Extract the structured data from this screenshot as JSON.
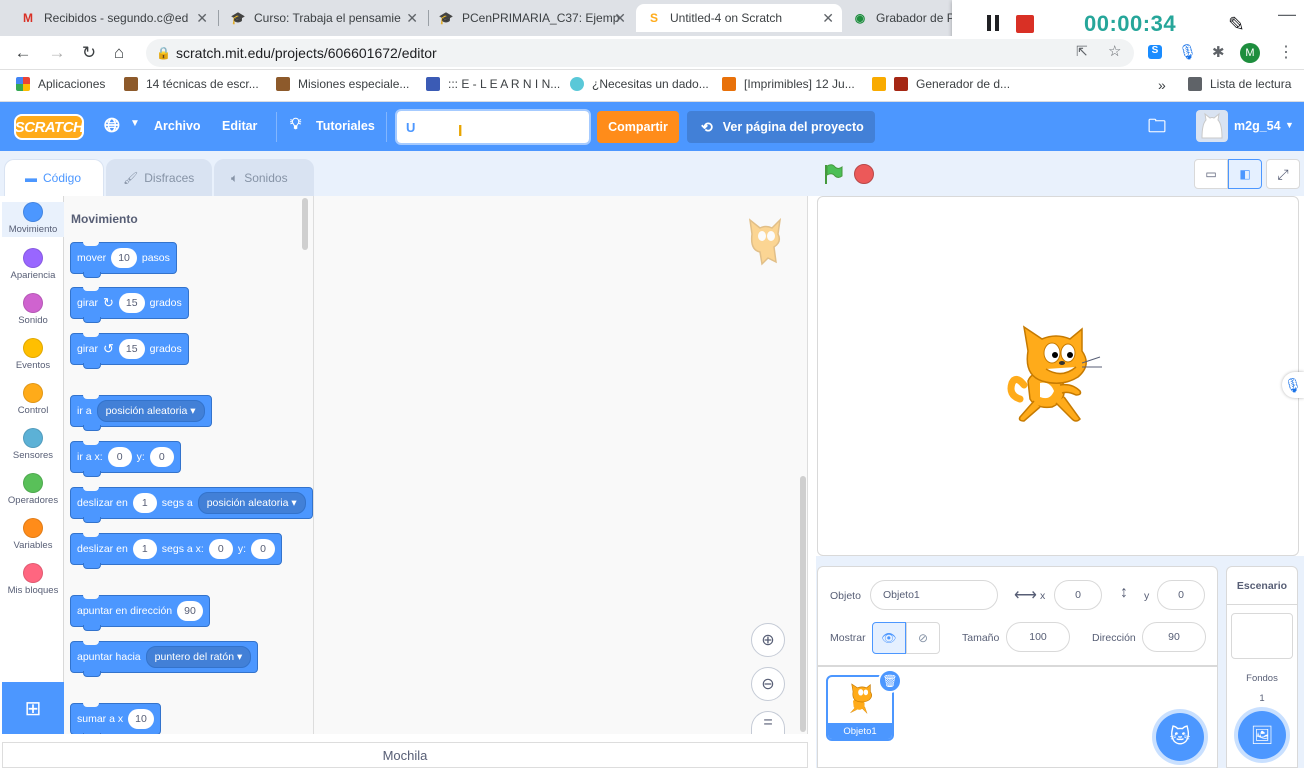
{
  "browser": {
    "tabs": [
      {
        "label": "Recibidos - segundo.c@ed",
        "icon": "gmail-icon"
      },
      {
        "label": "Curso: Trabaja el pensamie",
        "icon": "course-icon"
      },
      {
        "label": "PCenPRIMARIA_C37: Ejemp",
        "icon": "course-icon"
      },
      {
        "label": "Untitled-4 on Scratch",
        "icon": "scratch-icon"
      },
      {
        "label": "Grabador de P",
        "icon": "recorder-icon"
      }
    ],
    "url": "scratch.mit.edu/projects/606601672/editor",
    "bookmarks": [
      "Aplicaciones",
      "14 técnicas de escr...",
      "Misiones especiale...",
      "::: E - L E A R N I N...",
      "¿Necesitas un dado...",
      "[Imprimibles] 12 Ju...",
      "Generador de d...",
      "Lista de lectura"
    ],
    "profile_initial": "M"
  },
  "recorder": {
    "time": "00:00:34"
  },
  "menu": {
    "logo": "SCRATCH",
    "file": "Archivo",
    "edit": "Editar",
    "tutorials": "Tutoriales",
    "title_value": "U",
    "share": "Compartir",
    "see_project": "Ver página del proyecto",
    "username": "m2g_54"
  },
  "editor_tabs": {
    "code": "Código",
    "costumes": "Disfraces",
    "sounds": "Sonidos"
  },
  "categories": [
    {
      "label": "Movimiento",
      "color": "#4c97ff"
    },
    {
      "label": "Apariencia",
      "color": "#9966ff"
    },
    {
      "label": "Sonido",
      "color": "#cf63cf"
    },
    {
      "label": "Eventos",
      "color": "#ffbf00"
    },
    {
      "label": "Control",
      "color": "#ffab19"
    },
    {
      "label": "Sensores",
      "color": "#5cb1d6"
    },
    {
      "label": "Operadores",
      "color": "#59c059"
    },
    {
      "label": "Variables",
      "color": "#ff8c1a"
    },
    {
      "label": "Mis bloques",
      "color": "#ff6680"
    }
  ],
  "palette": {
    "heading": "Movimiento",
    "blocks": {
      "move": {
        "a": "mover",
        "v": "10",
        "b": "pasos"
      },
      "turn_right": {
        "a": "girar",
        "v": "15",
        "b": "grados"
      },
      "turn_left": {
        "a": "girar",
        "v": "15",
        "b": "grados"
      },
      "goto": {
        "a": "ir a",
        "d": "posición aleatoria"
      },
      "goto_xy": {
        "a": "ir a x:",
        "x": "0",
        "b": "y:",
        "y": "0"
      },
      "glide": {
        "a": "deslizar en",
        "v": "1",
        "b": "segs a",
        "d": "posición aleatoria"
      },
      "glide_xy": {
        "a": "deslizar en",
        "v": "1",
        "b": "segs a x:",
        "x": "0",
        "c": "y:",
        "y": "0"
      },
      "point_dir": {
        "a": "apuntar en dirección",
        "v": "90"
      },
      "point_towards": {
        "a": "apuntar hacia",
        "d": "puntero del ratón"
      },
      "change_x": {
        "a": "sumar a x",
        "v": "10"
      }
    }
  },
  "backpack": "Mochila",
  "sprite_info": {
    "object_label": "Objeto",
    "object_name": "Objeto1",
    "x_label": "x",
    "x": "0",
    "y_label": "y",
    "y": "0",
    "show_label": "Mostrar",
    "size_label": "Tamaño",
    "size": "100",
    "direction_label": "Dirección",
    "direction": "90"
  },
  "sprites": [
    {
      "name": "Objeto1"
    }
  ],
  "stage_panel": {
    "title": "Escenario",
    "backdrops_label": "Fondos",
    "backdrops_count": "1"
  }
}
